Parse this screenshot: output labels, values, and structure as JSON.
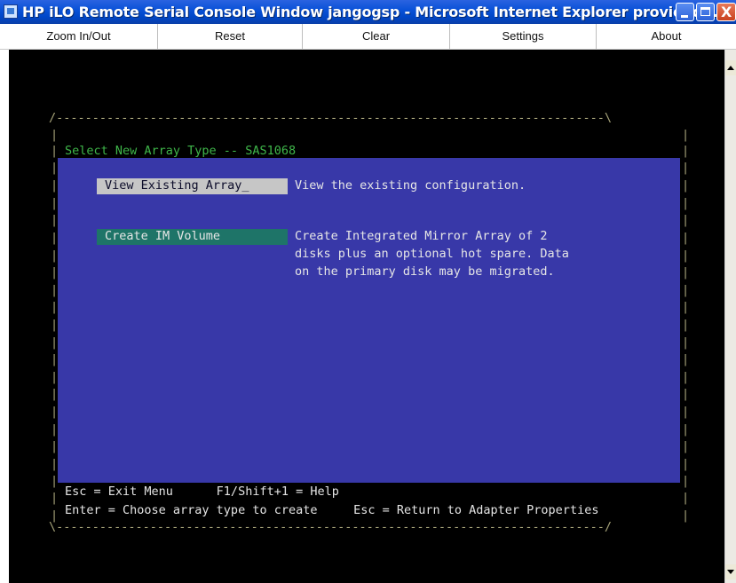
{
  "window": {
    "title": "HP iLO Remote Serial Console Window jangogsp - Microsoft Internet Explorer provided ...",
    "close_glyph": "X"
  },
  "menu": {
    "items": [
      {
        "label": "Zoom In/Out"
      },
      {
        "label": "Reset"
      },
      {
        "label": "Clear"
      },
      {
        "label": "Settings"
      },
      {
        "label": "About"
      }
    ]
  },
  "console": {
    "frame_top": "/----------------------------------------------------------------------------\\",
    "frame_bottom": "\\----------------------------------------------------------------------------/",
    "side_char": "|",
    "heading": "Select New Array Type -- SAS1068",
    "options": [
      {
        "label": "View Existing Array_",
        "description_lines": [
          "View the existing configuration."
        ]
      },
      {
        "label": "Create IM Volume",
        "description_lines": [
          "Create Integrated Mirror Array of 2",
          "disks plus an optional hot spare. Data",
          "on the primary disk may be migrated."
        ]
      }
    ],
    "footer_line1": "Esc = Exit Menu      F1/Shift+1 = Help",
    "footer_line2": "Enter = Choose array type to create     Esc = Return to Adapter Properties"
  },
  "colors": {
    "panel_blue": "#3838a8",
    "selected_highlight": "#c6c6c6",
    "option_teal": "#1e7468",
    "heading_green": "#3fb74a",
    "frame_tan": "#a8a57a"
  }
}
